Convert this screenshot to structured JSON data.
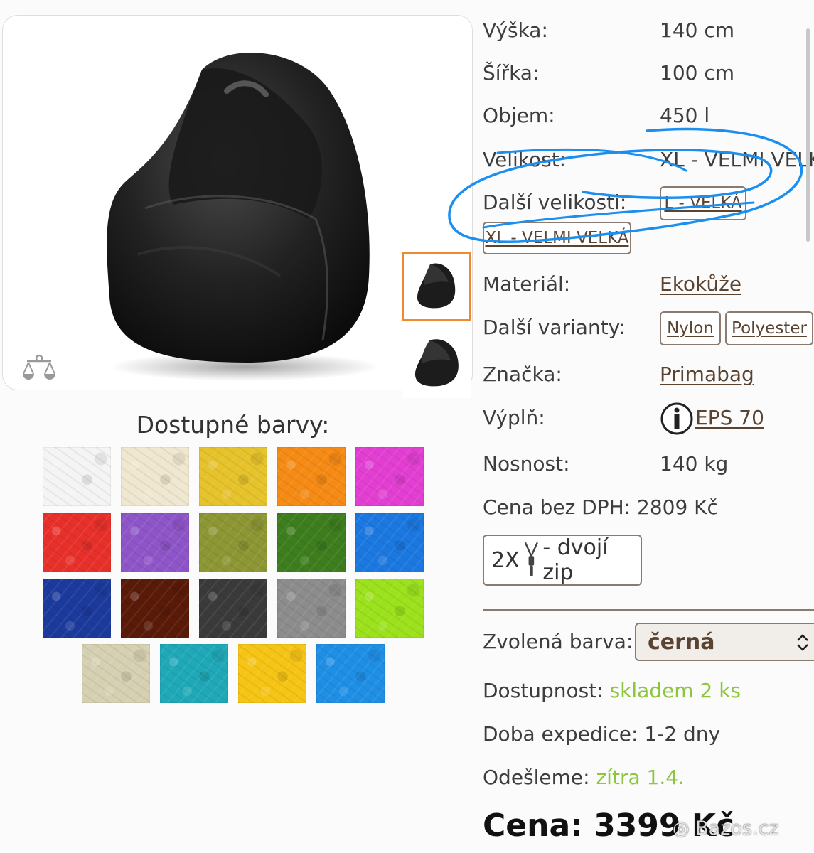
{
  "specs": {
    "height_label": "Výška:",
    "height_value": "140 cm",
    "width_label": "Šířka:",
    "width_value": "100 cm",
    "volume_label": "Objem:",
    "volume_value": "450 l",
    "size_label": "Velikost:",
    "size_value": "XL - VELMI VELK",
    "other_sizes_label": "Další velikosti:",
    "other_sizes": [
      "L - VELKÁ",
      "XL - VELMI VELKÁ"
    ],
    "material_label": "Materiál:",
    "material_value": "Ekokůže",
    "variants_label": "Další varianty:",
    "variants": [
      "Nylon",
      "Polyester"
    ],
    "brand_label": "Značka:",
    "brand_value": "Primabag",
    "filling_label": "Výplň:",
    "filling_value": "EPS 70",
    "capacity_label": "Nosnost:",
    "capacity_value": "140 kg",
    "price_no_vat": "Cena bez DPH: 2809 Kč"
  },
  "zip_badge": {
    "count": "2X",
    "text": "- dvojí zip"
  },
  "color_select": {
    "label": "Zvolená barva:",
    "value": "černá"
  },
  "availability": {
    "label": "Dostupnost:",
    "value": "skladem 2 ks"
  },
  "dispatch_time": "Doba expedice: 1-2 dny",
  "shipping": {
    "label": "Odešleme:",
    "value": "zítra 1.4."
  },
  "price": "Cena: 3399 Kč",
  "colors_title": "Dostupné barvy:",
  "swatches": [
    "#f4f4f4",
    "#efe7cf",
    "#e6c22b",
    "#f58a14",
    "#e23fd2",
    "#e8302b",
    "#8e55c8",
    "#8c9633",
    "#3d7d1e",
    "#1b78e0",
    "#1b3a9c",
    "#5a1a08",
    "#3a3a3a",
    "#8c8c8c",
    "#9be11c",
    "#d6d0b2",
    "#1fa9b8",
    "#f6c414",
    "#1f8fe6"
  ],
  "watermark": "Bazos.cz",
  "colors": {
    "accent_orange": "#ef8a2f",
    "link_brown": "#5a4330",
    "stock_green": "#8cc63f",
    "annotation_blue": "#1a8ff0"
  }
}
